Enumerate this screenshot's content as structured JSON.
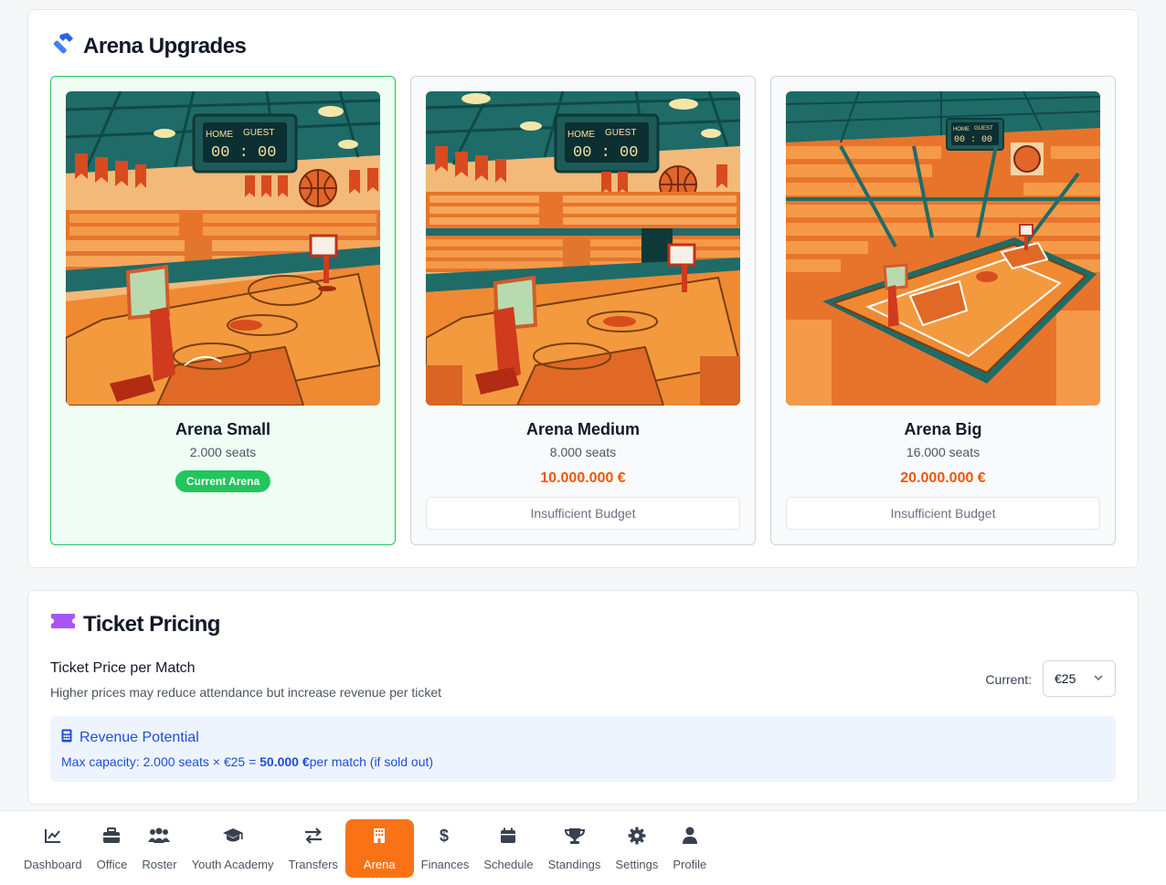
{
  "upgrades": {
    "title": "Arena Upgrades",
    "arenas": [
      {
        "name": "Arena Small",
        "seats": "2.000 seats",
        "status": "Current Arena"
      },
      {
        "name": "Arena Medium",
        "seats": "8.000 seats",
        "price": "10.000.000 €",
        "button": "Insufficient Budget"
      },
      {
        "name": "Arena Big",
        "seats": "16.000 seats",
        "price": "20.000.000 €",
        "button": "Insufficient Budget"
      }
    ],
    "scoreboard": {
      "home": "HOME",
      "guest": "GUEST",
      "score": "00 : 00"
    }
  },
  "pricing": {
    "title": "Ticket Pricing",
    "label": "Ticket Price per Match",
    "help": "Higher prices may reduce attendance but increase revenue per ticket",
    "current_label": "Current:",
    "current_value": "€25",
    "revenue": {
      "title": "Revenue Potential",
      "line_prefix": "Max capacity: 2.000 seats × €25 = ",
      "amount": "50.000 €",
      "line_suffix": "per match (if sold out)"
    }
  },
  "nav": {
    "items": [
      {
        "label": "Dashboard",
        "icon": "chart-line-icon"
      },
      {
        "label": "Office",
        "icon": "briefcase-icon"
      },
      {
        "label": "Roster",
        "icon": "users-icon"
      },
      {
        "label": "Youth Academy",
        "icon": "graduation-cap-icon"
      },
      {
        "label": "Transfers",
        "icon": "arrows-exchange-icon"
      },
      {
        "label": "Arena",
        "icon": "building-icon",
        "active": true
      },
      {
        "label": "Finances",
        "icon": "dollar-icon"
      },
      {
        "label": "Schedule",
        "icon": "calendar-icon"
      },
      {
        "label": "Standings",
        "icon": "trophy-icon"
      },
      {
        "label": "Settings",
        "icon": "gear-icon"
      },
      {
        "label": "Profile",
        "icon": "user-icon"
      }
    ]
  },
  "colors": {
    "accent": "#f97316",
    "success": "#22c55e",
    "price": "#ea580c",
    "info": "#1d4ed8",
    "ticket": "#a855f7",
    "hammer": "#3b82f6"
  }
}
